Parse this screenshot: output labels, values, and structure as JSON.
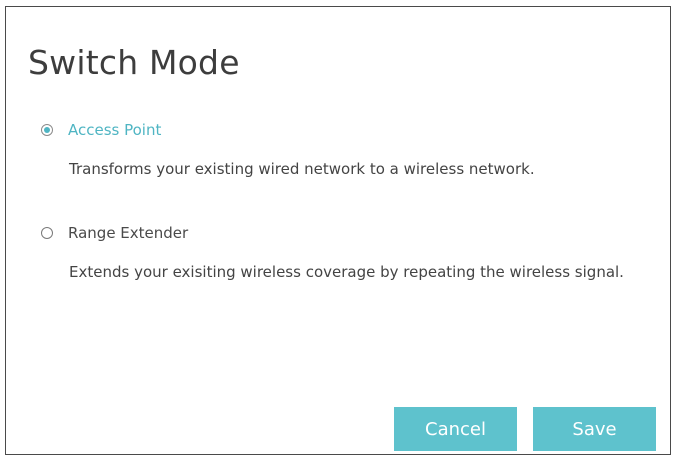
{
  "dialog": {
    "title": "Switch Mode",
    "options": [
      {
        "label": "Access Point",
        "description": "Transforms your existing wired network to a wireless network.",
        "selected": true
      },
      {
        "label": "Range Extender",
        "description": "Extends your exisiting wireless coverage by repeating the wireless signal.",
        "selected": false
      }
    ],
    "buttons": {
      "cancel_label": "Cancel",
      "save_label": "Save"
    }
  },
  "colors": {
    "accent": "#4fb5c3",
    "button": "#5ec2cd",
    "border": "#4a4a4a"
  }
}
